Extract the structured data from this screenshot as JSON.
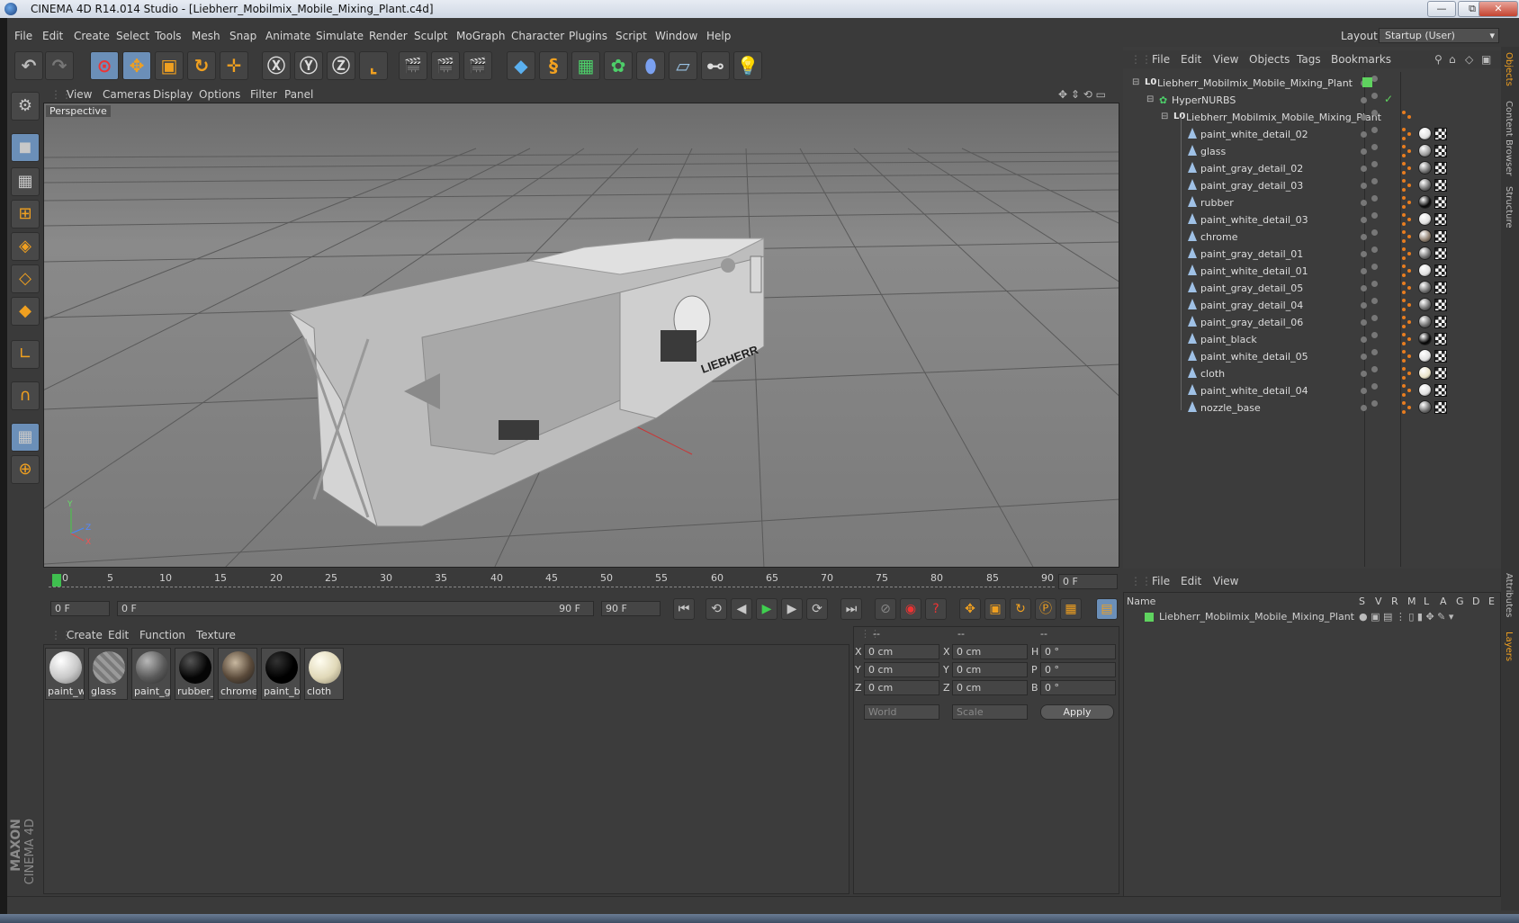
{
  "window": {
    "title": "CINEMA 4D R14.014 Studio - [Liebherr_Mobilmix_Mobile_Mixing_Plant.c4d]",
    "minimize": "—",
    "restore": "⧉",
    "close": "✕"
  },
  "menu": [
    "File",
    "Edit",
    "Create",
    "Select",
    "Tools",
    "Mesh",
    "Snap",
    "Animate",
    "Simulate",
    "Render",
    "Sculpt",
    "MoGraph",
    "Character",
    "Plugins",
    "Script",
    "Window",
    "Help"
  ],
  "layout": {
    "label": "Layout:",
    "value": "Startup (User)"
  },
  "viewport": {
    "menu": [
      "View",
      "Cameras",
      "Display",
      "Options",
      "Filter",
      "Panel"
    ],
    "label": "Perspective",
    "brand": "LIEBHERR",
    "axes": {
      "x": "X",
      "y": "Y",
      "z": "Z"
    }
  },
  "timeline": {
    "ticks": [
      "0",
      "5",
      "10",
      "15",
      "20",
      "25",
      "30",
      "35",
      "40",
      "45",
      "50",
      "55",
      "60",
      "65",
      "70",
      "75",
      "80",
      "85",
      "90"
    ],
    "current_frame": "0 F",
    "start_field": "0 F",
    "range_start": "0 F",
    "range_end": "90 F",
    "end_field": "90 F"
  },
  "materials": {
    "menu": [
      "Create",
      "Edit",
      "Function",
      "Texture"
    ],
    "items": [
      {
        "label": "paint_w",
        "color": "#e8e8e8"
      },
      {
        "label": "glass",
        "color": "#8a8a8a"
      },
      {
        "label": "paint_gi",
        "color": "#6a6a6a"
      },
      {
        "label": "rubber_",
        "color": "#0a0a0a"
      },
      {
        "label": "chrome",
        "color": "#7a6a5a"
      },
      {
        "label": "paint_bl",
        "color": "#050505"
      },
      {
        "label": "cloth",
        "color": "#e8e2c8"
      }
    ]
  },
  "coordinates": {
    "header": [
      "--",
      "--",
      "--"
    ],
    "rows": [
      {
        "a": "X",
        "a_val": "0 cm",
        "b": "X",
        "b_val": "0 cm",
        "c": "H",
        "c_val": "0 °"
      },
      {
        "a": "Y",
        "a_val": "0 cm",
        "b": "Y",
        "b_val": "0 cm",
        "c": "P",
        "c_val": "0 °"
      },
      {
        "a": "Z",
        "a_val": "0 cm",
        "b": "Z",
        "b_val": "0 cm",
        "c": "B",
        "c_val": "0 °"
      }
    ],
    "world": "World",
    "scale": "Scale",
    "apply": "Apply"
  },
  "objects": {
    "menu": [
      "File",
      "Edit",
      "View",
      "Objects",
      "Tags",
      "Bookmarks"
    ],
    "root": "Liebherr_Mobilmix_Mobile_Mixing_Plant",
    "hypernurbs": "HyperNURBS",
    "group": "Liebherr_Mobilmix_Mobile_Mixing_Plant",
    "children": [
      {
        "name": "paint_white_detail_02",
        "mat": "#e0e0e0"
      },
      {
        "name": "glass",
        "mat": "#9a9a9a"
      },
      {
        "name": "paint_gray_detail_02",
        "mat": "#6a6a6a"
      },
      {
        "name": "paint_gray_detail_03",
        "mat": "#6a6a6a"
      },
      {
        "name": "rubber",
        "mat": "#0a0a0a"
      },
      {
        "name": "paint_white_detail_03",
        "mat": "#e0e0e0"
      },
      {
        "name": "chrome",
        "mat": "#8a7a6a"
      },
      {
        "name": "paint_gray_detail_01",
        "mat": "#6a6a6a"
      },
      {
        "name": "paint_white_detail_01",
        "mat": "#e0e0e0"
      },
      {
        "name": "paint_gray_detail_05",
        "mat": "#6a6a6a"
      },
      {
        "name": "paint_gray_detail_04",
        "mat": "#6a6a6a"
      },
      {
        "name": "paint_gray_detail_06",
        "mat": "#6a6a6a"
      },
      {
        "name": "paint_black",
        "mat": "#050505"
      },
      {
        "name": "paint_white_detail_05",
        "mat": "#e0e0e0"
      },
      {
        "name": "cloth",
        "mat": "#e8e2c8"
      },
      {
        "name": "paint_white_detail_04",
        "mat": "#e0e0e0"
      },
      {
        "name": "nozzle_base",
        "mat": "#6a6a6a"
      }
    ]
  },
  "layers": {
    "menu": [
      "File",
      "Edit",
      "View"
    ],
    "columns": [
      "Name",
      "S",
      "V",
      "R",
      "M",
      "L",
      "A",
      "G",
      "D",
      "E"
    ],
    "items": [
      "Liebherr_Mobilmix_Mobile_Mixing_Plant"
    ]
  },
  "right_tabs": [
    "Objects",
    "Content Browser",
    "Structure",
    "Attributes",
    "Layers"
  ],
  "logo": {
    "line1": "MAXON",
    "line2": "CINEMA 4D"
  },
  "colors": {
    "accent": "#6b8fb8",
    "orange": "#e87d1f",
    "layer_green": "#5fd35f"
  }
}
